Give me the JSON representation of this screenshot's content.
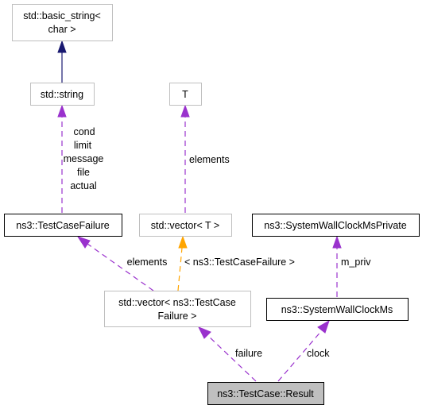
{
  "diagram": {
    "type": "collaboration-graph",
    "colors": {
      "inheritance": "#191970",
      "usage": "#9a32cd",
      "template": "#ffa500",
      "external_border": "#bfbfbf",
      "documented_border": "#000000",
      "root_fill": "#bfbfbf"
    },
    "nodes": {
      "basic_string": {
        "lines": [
          "std::basic_string<",
          "char >"
        ]
      },
      "string": {
        "lines": [
          "std::string"
        ]
      },
      "t": {
        "lines": [
          "T"
        ]
      },
      "test_case_failure": {
        "lines": [
          "ns3::TestCaseFailure"
        ]
      },
      "vector_t": {
        "lines": [
          "std::vector< T >"
        ]
      },
      "wallclock_private": {
        "lines": [
          "ns3::SystemWallClockMsPrivate"
        ]
      },
      "vector_tcf": {
        "lines": [
          "std::vector< ns3::TestCase",
          "Failure >"
        ]
      },
      "wallclock": {
        "lines": [
          "ns3::SystemWallClockMs"
        ]
      },
      "result": {
        "lines": [
          "ns3::TestCase::Result"
        ]
      }
    },
    "edges": {
      "string_to_basic": {
        "kind": "inheritance",
        "label": []
      },
      "tcf_to_string": {
        "kind": "usage",
        "label": [
          "cond",
          "limit",
          "message",
          "file",
          "actual"
        ]
      },
      "vectort_to_t": {
        "kind": "usage",
        "label": [
          "elements"
        ]
      },
      "vectortcf_to_tcf": {
        "kind": "usage",
        "label": [
          "elements"
        ]
      },
      "vectortcf_to_vectort": {
        "kind": "template",
        "label": [
          "< ns3::TestCaseFailure >"
        ]
      },
      "wallclock_to_private": {
        "kind": "usage",
        "label": [
          "m_priv"
        ]
      },
      "result_to_vectortcf": {
        "kind": "usage",
        "label": [
          "failure"
        ]
      },
      "result_to_wallclock": {
        "kind": "usage",
        "label": [
          "clock"
        ]
      }
    }
  }
}
